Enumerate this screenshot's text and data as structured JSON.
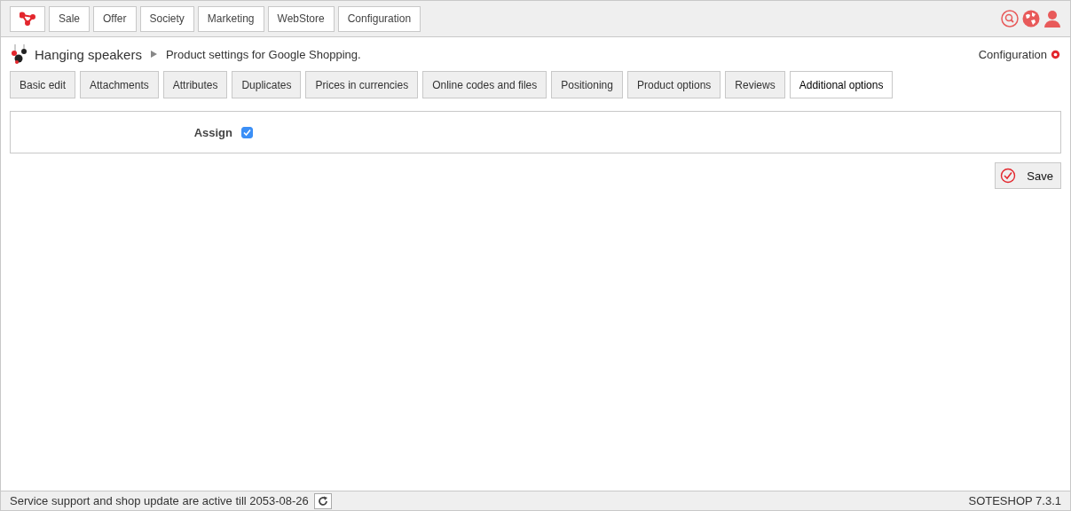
{
  "top_menu": [
    {
      "label": "Sale"
    },
    {
      "label": "Offer"
    },
    {
      "label": "Society"
    },
    {
      "label": "Marketing"
    },
    {
      "label": "WebStore"
    },
    {
      "label": "Configuration"
    }
  ],
  "breadcrumb": {
    "product": "Hanging speakers",
    "page": "Product settings for Google Shopping."
  },
  "config_link": "Configuration",
  "tabs": [
    {
      "label": "Basic edit",
      "selected": false
    },
    {
      "label": "Attachments",
      "selected": false
    },
    {
      "label": "Attributes",
      "selected": false
    },
    {
      "label": "Duplicates",
      "selected": false
    },
    {
      "label": "Prices in currencies",
      "selected": false
    },
    {
      "label": "Online codes and files",
      "selected": false
    },
    {
      "label": "Positioning",
      "selected": false
    },
    {
      "label": "Product options",
      "selected": false
    },
    {
      "label": "Reviews",
      "selected": false
    },
    {
      "label": "Additional options",
      "selected": true
    }
  ],
  "form": {
    "label": "Assign",
    "checked": true
  },
  "save_button": "Save",
  "status_bar": {
    "message": "Service support and shop update are active till 2053-08-26",
    "version": "SOTESHOP 7.3.1"
  }
}
